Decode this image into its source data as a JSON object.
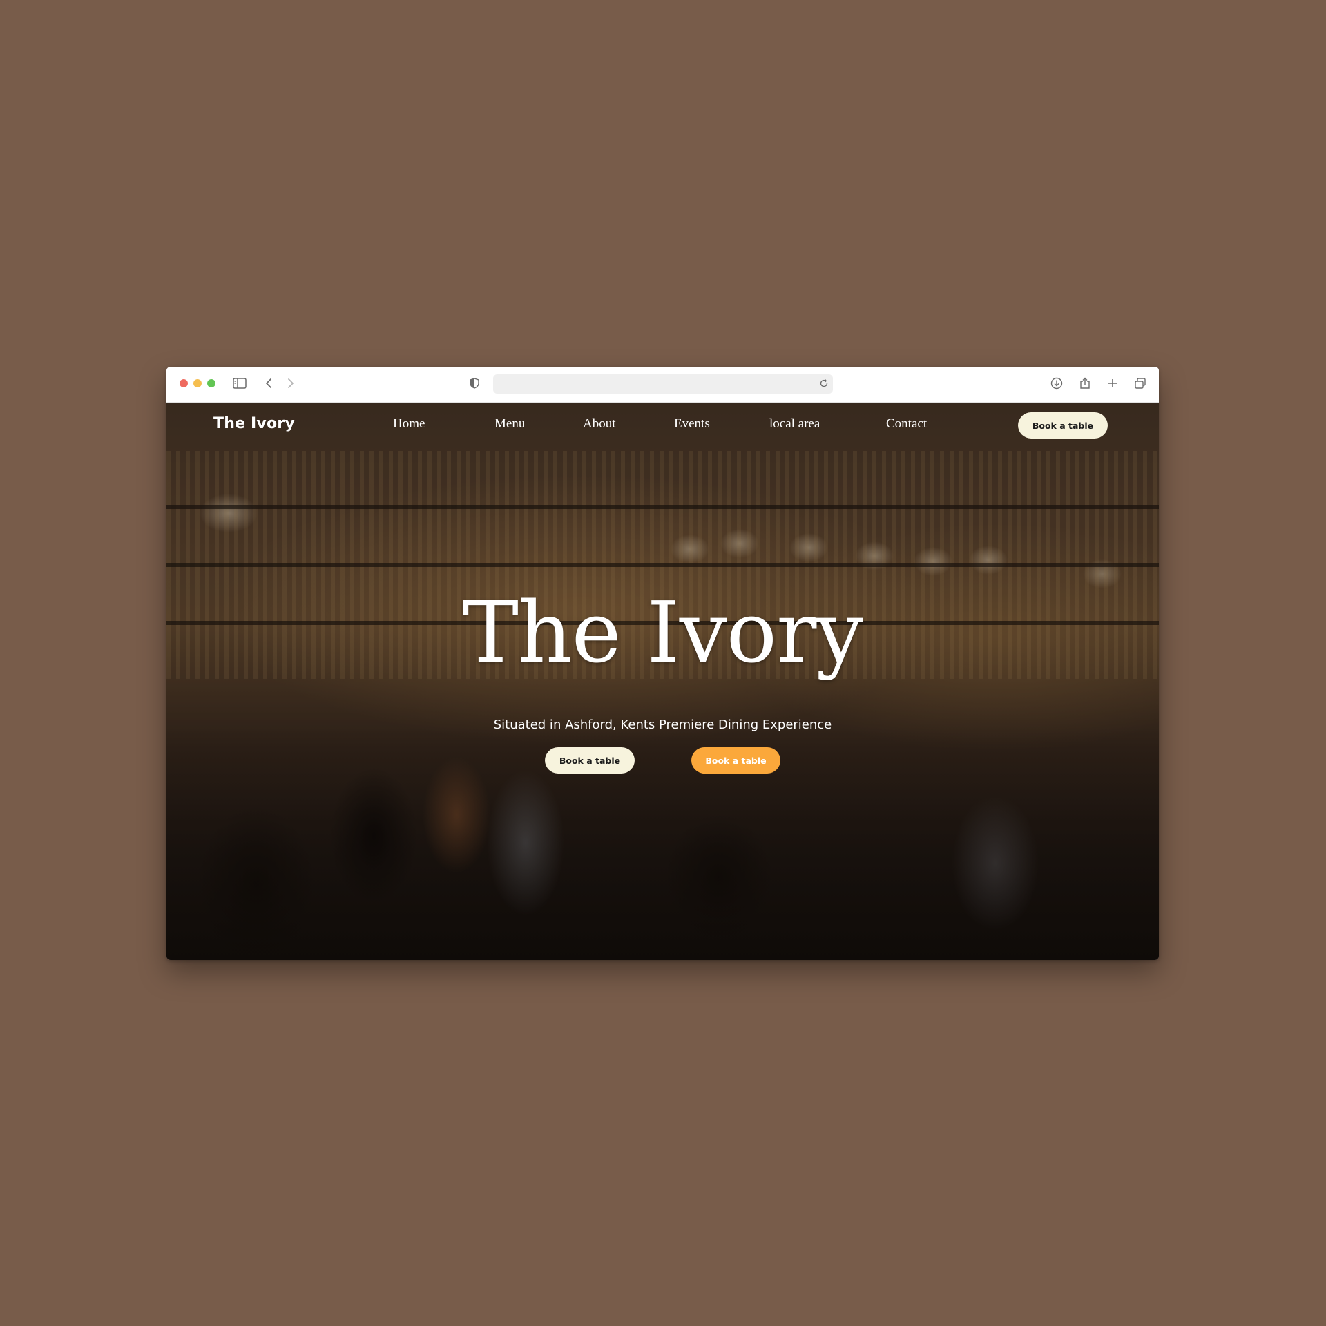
{
  "browser": {
    "address": ""
  },
  "nav": {
    "brand": "The Ivory",
    "links": [
      "Home",
      "Menu",
      "About",
      "Events",
      "local area",
      "Contact"
    ],
    "cta": "Book a table"
  },
  "hero": {
    "title": "The Ivory",
    "subtitle": "Situated in Ashford, Kents Premiere Dining Experience",
    "primary_button": "Book a table",
    "secondary_button": "Book a table"
  },
  "colors": {
    "page_background": "#785c4a",
    "accent_orange": "#fba83b",
    "button_cream": "#f7f3dd"
  }
}
